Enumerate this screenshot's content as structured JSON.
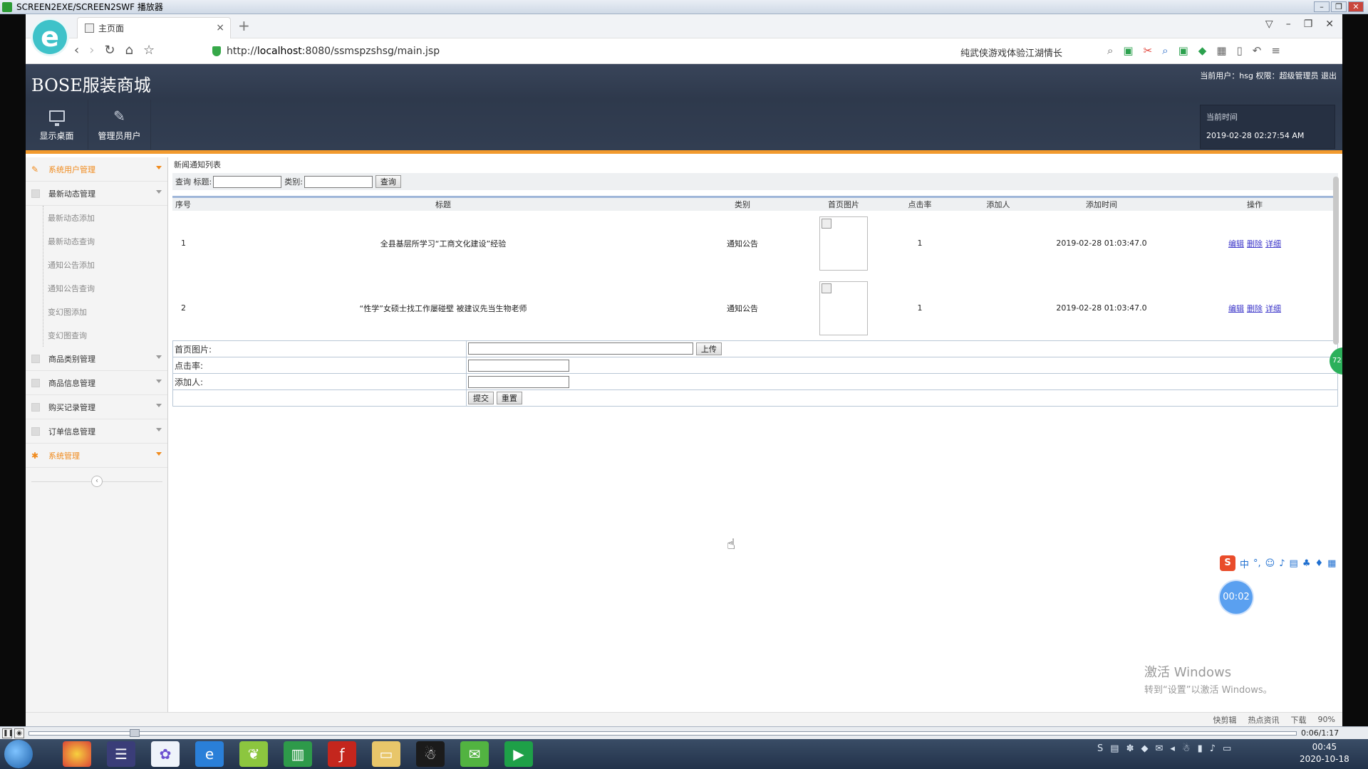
{
  "player": {
    "title": "SCREEN2EXE/SCREEN2SWF 播放器",
    "time": "0:06/1:17"
  },
  "browser": {
    "tab_title": "主页面",
    "url_prefix": "http://",
    "url_host": "localhost",
    "url_rest": ":8080/ssmspzshsg/main.jsp",
    "search_hint": "纯武侠游戏体验江湖情长",
    "status_items": [
      "快剪辑",
      "热点资讯",
      "下载",
      "90%"
    ]
  },
  "app": {
    "title": "BOSE服装商城",
    "user_info": "当前用户：hsg 权限：超级管理员 退出",
    "nav": [
      {
        "label": "显示桌面",
        "icon": "monitor-icon"
      },
      {
        "label": "管理员用户",
        "icon": "pencil-icon"
      }
    ],
    "time_label": "当前时间",
    "time_value": "2019-02-28 02:27:54 AM"
  },
  "sidebar": {
    "groups": [
      {
        "label": "系统用户管理",
        "highlight": true
      },
      {
        "label": "最新动态管理",
        "highlight": false
      },
      {
        "label": "商品类别管理",
        "highlight": false
      },
      {
        "label": "商品信息管理",
        "highlight": false
      },
      {
        "label": "购买记录管理",
        "highlight": false
      },
      {
        "label": "订单信息管理",
        "highlight": false
      },
      {
        "label": "系统管理",
        "highlight": true
      }
    ],
    "subitems": [
      "最新动态添加",
      "最新动态查询",
      "通知公告添加",
      "通知公告查询",
      "变幻图添加",
      "变幻图查询"
    ]
  },
  "main": {
    "page_title": "新闻通知列表",
    "query": {
      "label": "查询 标题:",
      "category_label": "类别:",
      "button": "查询"
    },
    "columns": [
      "序号",
      "标题",
      "类别",
      "首页图片",
      "点击率",
      "添加人",
      "添加时间",
      "操作"
    ],
    "rows": [
      {
        "no": "1",
        "title": "全县基层所学习“工商文化建设”经验",
        "category": "通知公告",
        "clicks": "1",
        "adder": "",
        "time": "2019-02-28 01:03:47.0"
      },
      {
        "no": "2",
        "title": "“性学”女硕士找工作屡碰壁 被建议先当生物老师",
        "category": "通知公告",
        "clicks": "1",
        "adder": "",
        "time": "2019-02-28 01:03:47.0"
      }
    ],
    "actions": [
      "编辑",
      "删除",
      "详细"
    ],
    "form": {
      "image_label": "首页图片:",
      "upload_button": "上传",
      "clicks_label": "点击率:",
      "adder_label": "添加人:",
      "submit_button": "提交",
      "reset_button": "重置"
    }
  },
  "overlay": {
    "side_ball": "72",
    "ime_lang": "中",
    "rec_timer": "00:02",
    "watermark_title": "激活 Windows",
    "watermark_sub": "转到“设置”以激活 Windows。"
  },
  "taskbar": {
    "clock_time": "00:45",
    "clock_date": "2020-10-18"
  }
}
